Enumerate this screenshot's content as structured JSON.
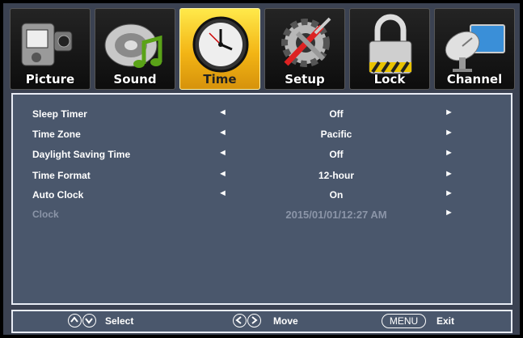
{
  "tabs": [
    {
      "label": "Picture",
      "icon": "camcorder-icon",
      "active": false
    },
    {
      "label": "Sound",
      "icon": "speaker-music-icon",
      "active": false
    },
    {
      "label": "Time",
      "icon": "clock-icon",
      "active": true
    },
    {
      "label": "Setup",
      "icon": "gear-tools-icon",
      "active": false
    },
    {
      "label": "Lock",
      "icon": "padlock-icon",
      "active": false
    },
    {
      "label": "Channel",
      "icon": "satellite-dish-icon",
      "active": false
    }
  ],
  "menu": {
    "rows": [
      {
        "label": "Sleep Timer",
        "value": "Off",
        "enabled": true
      },
      {
        "label": "Time Zone",
        "value": "Pacific",
        "enabled": true
      },
      {
        "label": "Daylight Saving Time",
        "value": "Off",
        "enabled": true
      },
      {
        "label": "Time Format",
        "value": "12-hour",
        "enabled": true
      },
      {
        "label": "Auto Clock",
        "value": "On",
        "enabled": true
      },
      {
        "label": "Clock",
        "value": "2015/01/01/12:27 AM",
        "enabled": false
      }
    ],
    "arrow_left": "◄",
    "arrow_right": "►"
  },
  "footer": {
    "select_label": "Select",
    "move_label": "Move",
    "menu_key": "MENU",
    "exit_label": "Exit"
  },
  "colors": {
    "active_tab": "#f3b515",
    "panel_bg": "#4a576c",
    "disabled_text": "#8b95a8"
  }
}
